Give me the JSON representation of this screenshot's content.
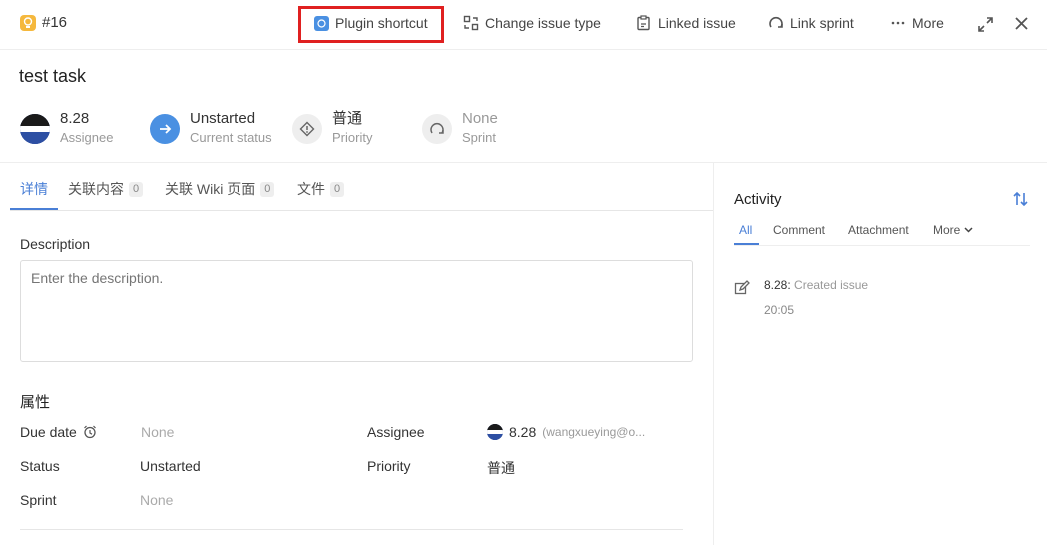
{
  "header": {
    "issue_number": "#16",
    "actions": {
      "plugin_shortcut": "Plugin shortcut",
      "change_issue_type": "Change issue type",
      "linked_issue": "Linked issue",
      "link_sprint": "Link sprint",
      "more": "More"
    }
  },
  "issue": {
    "title": "test task",
    "summary": {
      "assignee_value": "8.28",
      "assignee_label": "Assignee",
      "status_value": "Unstarted",
      "status_label": "Current status",
      "priority_value": "普通",
      "priority_label": "Priority",
      "sprint_value": "None",
      "sprint_label": "Sprint"
    }
  },
  "tabs": [
    {
      "label": "详情"
    },
    {
      "label": "关联内容",
      "count": "0"
    },
    {
      "label": "关联 Wiki 页面",
      "count": "0"
    },
    {
      "label": "文件",
      "count": "0"
    }
  ],
  "description": {
    "label": "Description",
    "placeholder": "Enter the description."
  },
  "properties": {
    "title": "属性",
    "due_date_label": "Due date",
    "due_date_value": "None",
    "status_label": "Status",
    "status_value": "Unstarted",
    "sprint_label": "Sprint",
    "sprint_value": "None",
    "assignee_label": "Assignee",
    "assignee_name": "8.28",
    "assignee_email": "(wangxueying@o...",
    "priority_label": "Priority",
    "priority_value": "普通"
  },
  "activity": {
    "title": "Activity",
    "tabs": [
      "All",
      "Comment",
      "Attachment",
      "More"
    ],
    "entries": [
      {
        "user": "8.28:",
        "action": "Created issue",
        "time": "20:05"
      }
    ]
  },
  "colors": {
    "accent": "#4a7fd6",
    "highlight_box": "#e02020",
    "issue_icon": "#f5b83d"
  }
}
